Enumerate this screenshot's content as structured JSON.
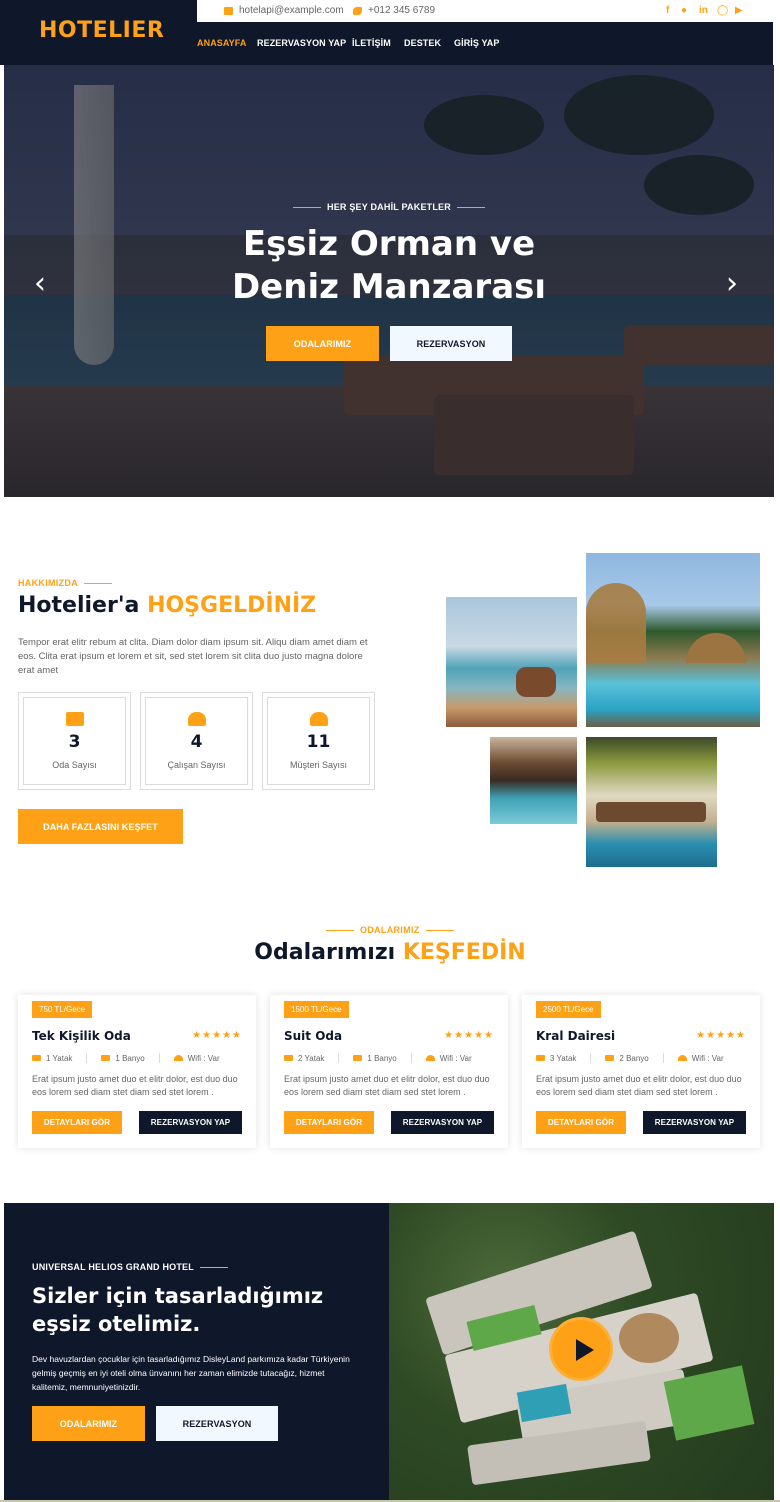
{
  "brand": {
    "logo": "HOTELIER",
    "accent_color": "#fea116",
    "dark_color": "#0f172b"
  },
  "topbar": {
    "email": "hotelapi@example.com",
    "phone": "+012 345 6789",
    "social": [
      "facebook-icon",
      "twitter-icon",
      "linkedin-icon",
      "instagram-icon",
      "youtube-icon"
    ]
  },
  "nav": {
    "items": [
      "ANASAYFA",
      "REZERVASYON YAP",
      "İLETİŞİM",
      "DESTEK",
      "GİRİŞ YAP"
    ],
    "active": "ANASAYFA"
  },
  "hero": {
    "kicker": "HER ŞEY DAHİL PAKETLER",
    "title_line1": "Eşsiz Orman ve",
    "title_line2": "Deniz Manzarası",
    "btn_rooms": "ODALARIMIZ",
    "btn_reservation": "REZERVASYON"
  },
  "about": {
    "kicker": "HAKKIMIZDA",
    "title_main": "Hotelier'a ",
    "title_accent": "HOŞGELDİNİZ",
    "text": "Tempor erat elitr rebum at clita. Diam dolor diam ipsum sit. Aliqu diam amet diam et eos. Clita erat ipsum et lorem et sit, sed stet lorem sit clita duo justo magna dolore erat amet",
    "stats": [
      {
        "value": "3",
        "label": "Oda Sayısı",
        "icon": "hotel-icon"
      },
      {
        "value": "4",
        "label": "Çalışan Sayısı",
        "icon": "users-cog-icon"
      },
      {
        "value": "11",
        "label": "Müşteri Sayısı",
        "icon": "users-icon"
      }
    ],
    "cta": "DAHA FAZLASINI KEŞFET"
  },
  "rooms": {
    "kicker": "ODALARIMIZ",
    "title_main": "Odalarımızı ",
    "title_accent": "KEŞFEDİN",
    "cards": [
      {
        "price": "750 TL/Gece",
        "name": "Tek Kişilik Oda",
        "rating": 5,
        "bed": "1 Yatak",
        "bath": "1 Banyo",
        "wifi": "Wifi : Var",
        "desc": "Erat ipsum justo amet duo et elitr dolor, est duo duo eos lorem sed diam stet diam sed stet lorem .",
        "detail": "DETAYLARI GÖR",
        "book": "REZERVASYON YAP"
      },
      {
        "price": "1500 TL/Gece",
        "name": "Suit Oda",
        "rating": 5,
        "bed": "2 Yatak",
        "bath": "1 Banyo",
        "wifi": "Wifi : Var",
        "desc": "Erat ipsum justo amet duo et elitr dolor, est duo duo eos lorem sed diam stet diam sed stet lorem .",
        "detail": "DETAYLARI GÖR",
        "book": "REZERVASYON YAP"
      },
      {
        "price": "2500 TL/Gece",
        "name": "Kral Dairesi",
        "rating": 5,
        "bed": "3 Yatak",
        "bath": "2 Banyo",
        "wifi": "Wifi : Var",
        "desc": "Erat ipsum justo amet duo et elitr dolor, est duo duo eos lorem sed diam stet diam sed stet lorem .",
        "detail": "DETAYLARI GÖR",
        "book": "REZERVASYON YAP"
      }
    ]
  },
  "promo": {
    "kicker": "UNIVERSAL HELIOS GRAND HOTEL",
    "title_line1": "Sizler için tasarladığımız",
    "title_line2": "eşsiz otelimiz.",
    "text": "Dev havuzlardan çocuklar için tasarladığımız DisleyLand parkımıza kadar Türkiyenin gelmiş geçmiş en iyi oteli olma ünvanını her zaman elimizde tutacağız, hizmet kalitemiz, memnuniyetinizdir.",
    "btn_rooms": "ODALARIMIZ",
    "btn_reservation": "REZERVASYON"
  }
}
